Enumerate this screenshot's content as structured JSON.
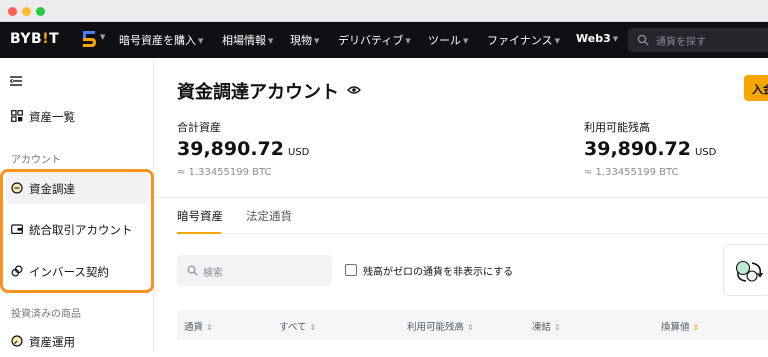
{
  "nav": {
    "logo_prefix": "BYB",
    "logo_bang": "!",
    "logo_suffix": "T",
    "items": [
      {
        "label": "暗号資産を購入"
      },
      {
        "label": "相場情報"
      },
      {
        "label": "現物"
      },
      {
        "label": "デリバティブ"
      },
      {
        "label": "ツール"
      },
      {
        "label": "ファイナンス"
      },
      {
        "label": "Web3"
      }
    ],
    "search_placeholder": "通貨を探す"
  },
  "sidebar": {
    "overview_label": "資産一覧",
    "account_section": "アカウント",
    "accounts": [
      {
        "label": "資金調達",
        "icon": "funding-coin-icon",
        "active": true
      },
      {
        "label": "統合取引アカウント",
        "icon": "wallet-icon",
        "active": false
      },
      {
        "label": "インバース契約",
        "icon": "inverse-link-icon",
        "active": false
      }
    ],
    "invested_section": "投資済みの商品",
    "invested_items": [
      {
        "label": "資産運用",
        "icon": "earn-gauge-icon"
      }
    ]
  },
  "main": {
    "title": "資金調達アカウント",
    "deposit_label": "入金",
    "total": {
      "label": "合計資産",
      "value": "39,890.72",
      "unit": "USD",
      "btc": "≈ 1.33455199 BTC"
    },
    "available": {
      "label": "利用可能残高",
      "value": "39,890.72",
      "unit": "USD",
      "btc": "≈ 1.33455199 BTC"
    },
    "tabs": [
      {
        "label": "暗号資産",
        "active": true
      },
      {
        "label": "法定通貨",
        "active": false
      }
    ],
    "search_placeholder": "検索",
    "hide_zero_label": "残高がゼロの通貨を非表示にする",
    "columns": [
      "通貨",
      "すべて",
      "利用可能残高",
      "凍結",
      "換算値"
    ]
  },
  "colors": {
    "accent": "#f7a600",
    "highlight_border": "#f7931e",
    "nav_bg": "#101014"
  }
}
